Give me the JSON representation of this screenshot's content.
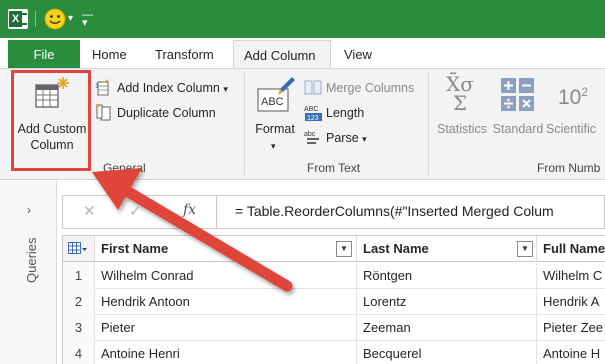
{
  "titlebar": {
    "app_icon": "excel-icon",
    "smiley_icon": "smiley-icon"
  },
  "tabs": {
    "file": "File",
    "home": "Home",
    "transform": "Transform",
    "add_column": "Add Column",
    "view": "View"
  },
  "ribbon": {
    "general": {
      "label": "General",
      "add_custom_column": "Add Custom Column",
      "add_index_column": "Add Index Column",
      "duplicate_column": "Duplicate Column"
    },
    "from_text": {
      "label": "From Text",
      "format": "Format",
      "merge_columns": "Merge Columns",
      "length": "Length",
      "parse": "Parse"
    },
    "from_number": {
      "label": "From Numb",
      "statistics": "Statistics",
      "standard": "Standard",
      "scientific": "Scientific"
    }
  },
  "queries_pane": {
    "label": "Queries"
  },
  "formula_bar": {
    "fx": "fx",
    "formula": "= Table.ReorderColumns(#\"Inserted Merged Colum"
  },
  "grid": {
    "headers": [
      "First Name",
      "Last Name",
      "Full Name"
    ],
    "rows": [
      {
        "n": "1",
        "first": "Wilhelm Conrad",
        "last": "Röntgen",
        "full": "Wilhelm C"
      },
      {
        "n": "2",
        "first": "Hendrik Antoon",
        "last": "Lorentz",
        "full": "Hendrik A"
      },
      {
        "n": "3",
        "first": "Pieter",
        "last": "Zeeman",
        "full": "Pieter Zee"
      },
      {
        "n": "4",
        "first": "Antoine Henri",
        "last": "Becquerel",
        "full": "Antoine H"
      }
    ]
  },
  "colors": {
    "excel_green": "#2a8c3d",
    "highlight_red": "#e0443a",
    "ribbon_bg": "#f3f3f3"
  }
}
